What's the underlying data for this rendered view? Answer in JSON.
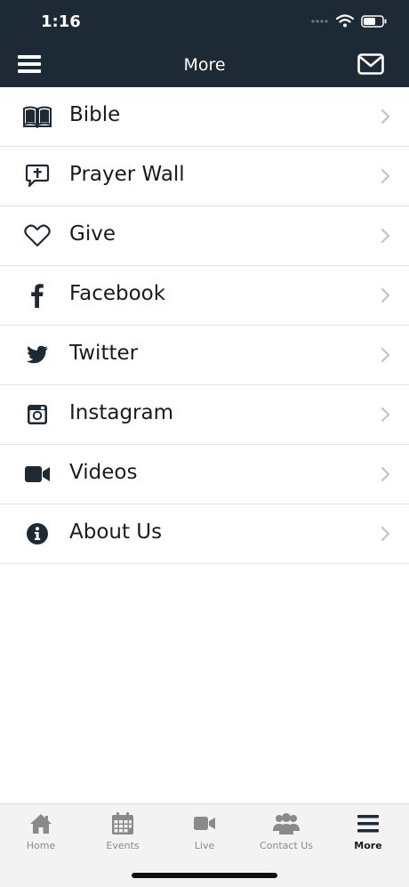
{
  "status_bar": {
    "time": "1:16"
  },
  "header": {
    "title": "More",
    "menu_icon": "hamburger-menu-icon",
    "mail_icon": "envelope-icon"
  },
  "menu_items": [
    {
      "label": "Bible",
      "icon": "open-book-icon"
    },
    {
      "label": "Prayer Wall",
      "icon": "speech-bubble-cross-icon"
    },
    {
      "label": "Give",
      "icon": "heart-icon"
    },
    {
      "label": "Facebook",
      "icon": "facebook-icon"
    },
    {
      "label": "Twitter",
      "icon": "twitter-icon"
    },
    {
      "label": "Instagram",
      "icon": "instagram-icon"
    },
    {
      "label": "Videos",
      "icon": "video-camera-icon"
    },
    {
      "label": "About Us",
      "icon": "info-icon"
    }
  ],
  "tabs": [
    {
      "label": "Home",
      "icon": "home-icon",
      "active": false
    },
    {
      "label": "Events",
      "icon": "calendar-icon",
      "active": false
    },
    {
      "label": "Live",
      "icon": "video-camera-icon",
      "active": false
    },
    {
      "label": "Contact Us",
      "icon": "people-group-icon",
      "active": false
    },
    {
      "label": "More",
      "icon": "hamburger-menu-icon",
      "active": true
    }
  ],
  "colors": {
    "header_bg": "#1d2a35",
    "icon_color": "#1d2a35",
    "divider": "#e3e3e3",
    "chevron": "#c4c4c4",
    "tab_bar_bg": "#f3f3f3",
    "tab_inactive": "#8a8a8a",
    "tab_active": "#1b1b1b"
  }
}
